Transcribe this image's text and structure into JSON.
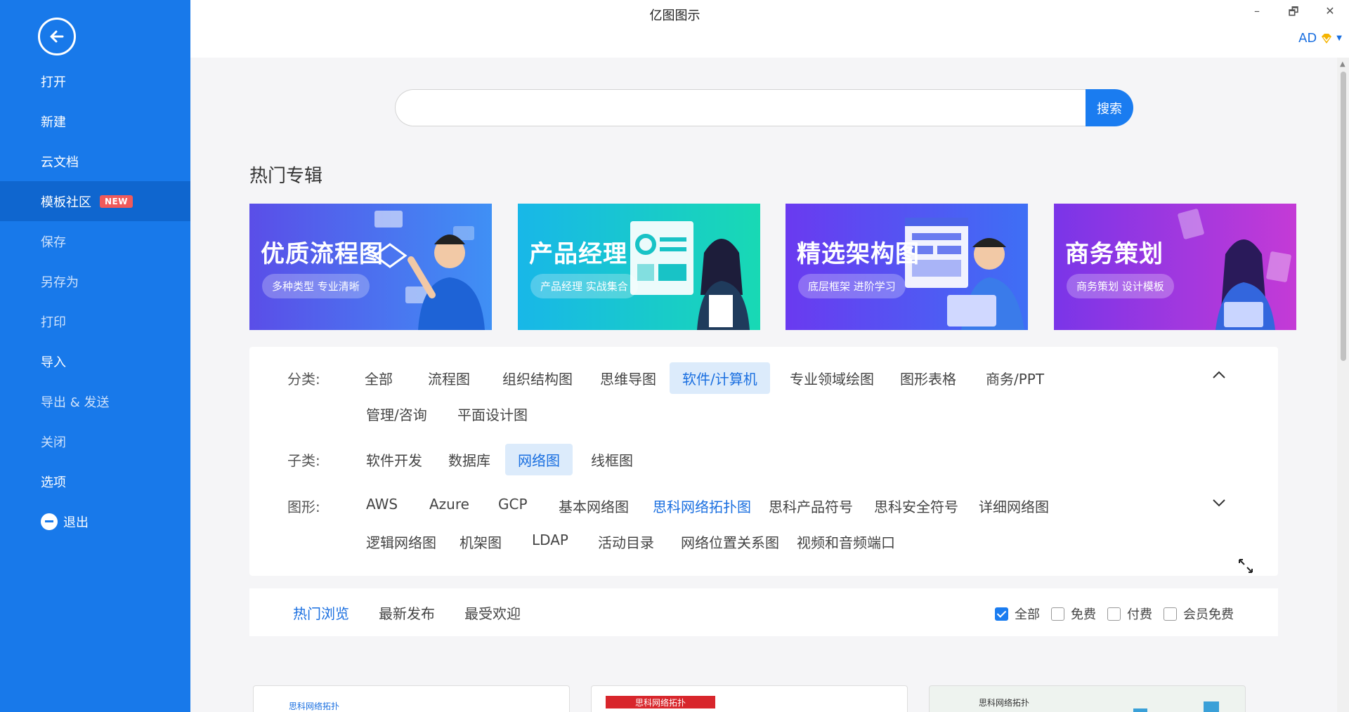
{
  "window": {
    "title": "亿图图示",
    "minimize": "–",
    "restore": "🗗",
    "close": "✕",
    "user_initials": "AD"
  },
  "sidebar": {
    "items": [
      {
        "label": "打开"
      },
      {
        "label": "新建"
      },
      {
        "label": "云文档"
      },
      {
        "label": "模板社区",
        "badge": "NEW"
      },
      {
        "label": "保存"
      },
      {
        "label": "另存为"
      },
      {
        "label": "打印"
      },
      {
        "label": "导入"
      },
      {
        "label": "导出 & 发送"
      },
      {
        "label": "关闭"
      },
      {
        "label": "选项"
      },
      {
        "label": "退出"
      }
    ]
  },
  "search": {
    "placeholder": "",
    "button_label": "搜索"
  },
  "hot": {
    "section_title": "热门专辑",
    "banners": [
      {
        "title": "优质流程图",
        "subtitle": "多种类型 专业清晰"
      },
      {
        "title": "产品经理",
        "subtitle": "产品经理 实战集合"
      },
      {
        "title": "精选架构图",
        "subtitle": "底层框架 进阶学习"
      },
      {
        "title": "商务策划",
        "subtitle": "商务策划 设计模板"
      }
    ]
  },
  "filters": {
    "category_label": "分类:",
    "categories": [
      "全部",
      "流程图",
      "组织结构图",
      "思维导图",
      "软件/计算机",
      "专业领域绘图",
      "图形表格",
      "商务/PPT",
      "管理/咨询",
      "平面设计图"
    ],
    "selected_category": "软件/计算机",
    "subcategory_label": "子类:",
    "subcategories": [
      "软件开发",
      "数据库",
      "网络图",
      "线框图"
    ],
    "selected_subcategory": "网络图",
    "shape_label": "图形:",
    "shapes": [
      "AWS",
      "Azure",
      "GCP",
      "基本网络图",
      "思科网络拓扑图",
      "思科产品符号",
      "思科安全符号",
      "详细网络图",
      "逻辑网络图",
      "机架图",
      "LDAP",
      "活动目录",
      "网络位置关系图",
      "视频和音频端口"
    ],
    "highlighted_shape": "思科网络拓扑图"
  },
  "sort": {
    "tabs": [
      "热门浏览",
      "最新发布",
      "最受欢迎"
    ],
    "active_tab": "热门浏览",
    "price_filters": [
      {
        "label": "全部",
        "checked": true
      },
      {
        "label": "免费",
        "checked": false
      },
      {
        "label": "付费",
        "checked": false
      },
      {
        "label": "会员免费",
        "checked": false
      }
    ]
  },
  "cards": [
    {
      "label": "思科网络拓扑"
    },
    {
      "label": "思科网络拓扑"
    },
    {
      "label": "思科网络拓扑"
    }
  ],
  "colors": {
    "sidebar_bg": "#1879ea",
    "accent": "#1a7cf0",
    "badge": "#f05a5a"
  }
}
